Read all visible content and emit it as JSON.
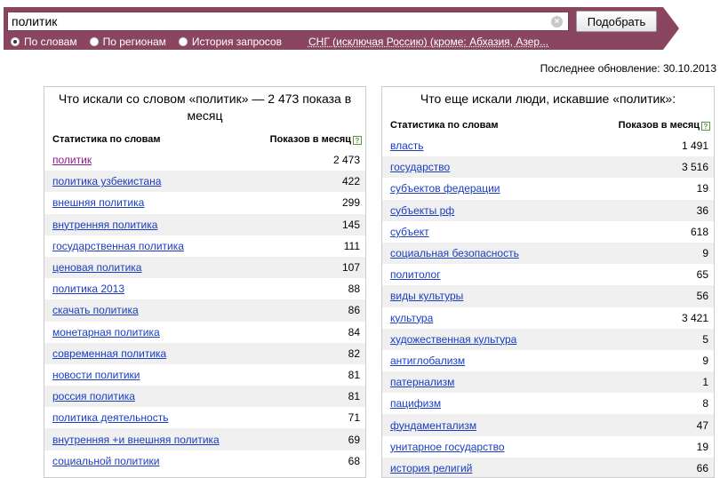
{
  "search": {
    "query": "политик",
    "submit_label": "Подобрать",
    "clear_glyph": "×"
  },
  "modes": [
    {
      "label": "По словам",
      "selected": true
    },
    {
      "label": "По регионам",
      "selected": false
    },
    {
      "label": "История запросов",
      "selected": false
    }
  ],
  "region": "СНГ (исключая Россию) (кроме: Абхазия, Азер...",
  "last_updated": "Последнее обновление: 30.10.2013",
  "colors": {
    "band": "#8a4660",
    "link": "#1a3dc1",
    "visited_link": "#8a1b8a"
  },
  "left": {
    "title": "Что искали со словом «политик» — 2 473 показа в месяц",
    "col_words": "Статистика по словам",
    "col_count": "Показов в месяц",
    "rows": [
      {
        "term": "политик",
        "count": "2 473"
      },
      {
        "term": "политика узбекистана",
        "count": "422"
      },
      {
        "term": "внешняя политика",
        "count": "299"
      },
      {
        "term": "внутренняя политика",
        "count": "145"
      },
      {
        "term": "государственная политика",
        "count": "111"
      },
      {
        "term": "ценовая политика",
        "count": "107"
      },
      {
        "term": "политика 2013",
        "count": "88"
      },
      {
        "term": "скачать политика",
        "count": "86"
      },
      {
        "term": "монетарная политика",
        "count": "84"
      },
      {
        "term": "современная политика",
        "count": "82"
      },
      {
        "term": "новости политики",
        "count": "81"
      },
      {
        "term": "россия политика",
        "count": "81"
      },
      {
        "term": "политика деятельность",
        "count": "71"
      },
      {
        "term": "внутренняя +и внешняя политика",
        "count": "69"
      },
      {
        "term": "социальной политики",
        "count": "68"
      }
    ]
  },
  "right": {
    "title": "Что еще искали люди, искавшие «политик»:",
    "col_words": "Статистика по словам",
    "col_count": "Показов в месяц",
    "rows": [
      {
        "term": "власть",
        "count": "1 491"
      },
      {
        "term": "государство",
        "count": "3 516"
      },
      {
        "term": "субъектов федерации",
        "count": "19"
      },
      {
        "term": "субъекты рф",
        "count": "36"
      },
      {
        "term": "субъект",
        "count": "618"
      },
      {
        "term": "социальная безопасность",
        "count": "9"
      },
      {
        "term": "политолог",
        "count": "65"
      },
      {
        "term": "виды культуры",
        "count": "56"
      },
      {
        "term": "культура",
        "count": "3 421"
      },
      {
        "term": "художественная культура",
        "count": "5"
      },
      {
        "term": "антиглобализм",
        "count": "9"
      },
      {
        "term": "патернализм",
        "count": "1"
      },
      {
        "term": "пацифизм",
        "count": "8"
      },
      {
        "term": "фундаментализм",
        "count": "47"
      },
      {
        "term": "унитарное государство",
        "count": "19"
      },
      {
        "term": "история религий",
        "count": "66"
      }
    ]
  }
}
